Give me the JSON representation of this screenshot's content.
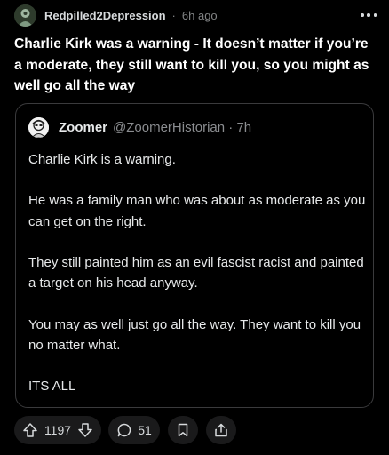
{
  "post": {
    "username": "Redpilled2Depression",
    "separator": "·",
    "time": "6h ago",
    "title": "Charlie Kirk was a warning - It doesn’t matter if you’re a moderate, they still want to kill you, so you might as well go all the way"
  },
  "quote": {
    "name": "Zoomer",
    "handle_time": "@ZoomerHistorian · 7h",
    "paragraphs": [
      "Charlie Kirk is a warning.",
      "He was a family man who was about as moderate as you can get on the right.",
      "They still painted him as an evil fascist racist and painted a target on his head anyway.",
      "You may as well just go all the way. They want to kill you no matter what.",
      "ITS ALL"
    ]
  },
  "actions": {
    "votes": "1197",
    "comments": "51"
  },
  "icons": {
    "avatar": "user-avatar-icon",
    "more": "more-options-icon",
    "upvote": "upvote-arrow-icon",
    "downvote": "downvote-arrow-icon",
    "comment": "comment-bubble-icon",
    "save": "bookmark-icon",
    "share": "share-icon"
  }
}
